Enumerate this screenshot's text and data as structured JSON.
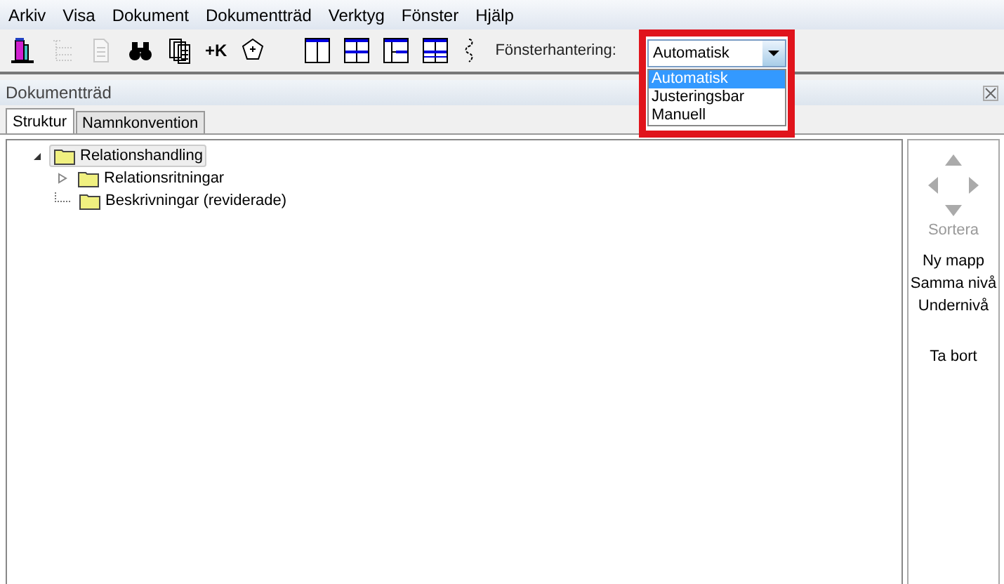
{
  "menu": [
    "Arkiv",
    "Visa",
    "Dokument",
    "Dokumentträd",
    "Verktyg",
    "Fönster",
    "Hjälp"
  ],
  "toolbar": {
    "tools": [
      {
        "kind": "tower",
        "disabled": false
      },
      {
        "kind": "tree",
        "disabled": true
      },
      {
        "kind": "page",
        "disabled": true
      },
      {
        "kind": "binoculars",
        "disabled": false
      },
      {
        "kind": "pages",
        "disabled": false
      },
      {
        "kind": "text",
        "label": "+K",
        "disabled": false
      },
      {
        "kind": "pentagon",
        "disabled": false
      }
    ],
    "layouts": [
      {
        "kind": "full"
      },
      {
        "kind": "grid"
      },
      {
        "kind": "split"
      },
      {
        "kind": "rows"
      }
    ],
    "window_mode": {
      "label": "Fönsterhantering:",
      "value": "Automatisk",
      "options": [
        {
          "label": "Automatisk",
          "selected": true
        },
        {
          "label": "Justeringsbar",
          "selected": false
        },
        {
          "label": "Manuell",
          "selected": false
        }
      ]
    }
  },
  "panel": {
    "title": "Dokumentträd",
    "tabs": [
      {
        "label": "Struktur",
        "selected": true
      },
      {
        "label": "Namnkonvention",
        "selected": false
      }
    ],
    "tree": [
      {
        "label": "Relationshandling",
        "expandable": true,
        "expanded": true,
        "selected": true,
        "children": [
          {
            "label": "Relationsritningar",
            "expandable": true,
            "expanded": false,
            "selected": false
          },
          {
            "label": "Beskrivningar (reviderade)",
            "expandable": false,
            "expanded": false,
            "selected": false
          }
        ]
      }
    ],
    "side": {
      "arrows_disabled": true,
      "actions": [
        {
          "label": "Sortera",
          "disabled": true
        },
        {
          "label": "Ny mapp",
          "disabled": false
        },
        {
          "label": "Samma nivå",
          "disabled": false
        },
        {
          "label": "Undernivå",
          "disabled": false
        },
        {
          "label": "Ta bort",
          "disabled": false
        }
      ]
    }
  }
}
